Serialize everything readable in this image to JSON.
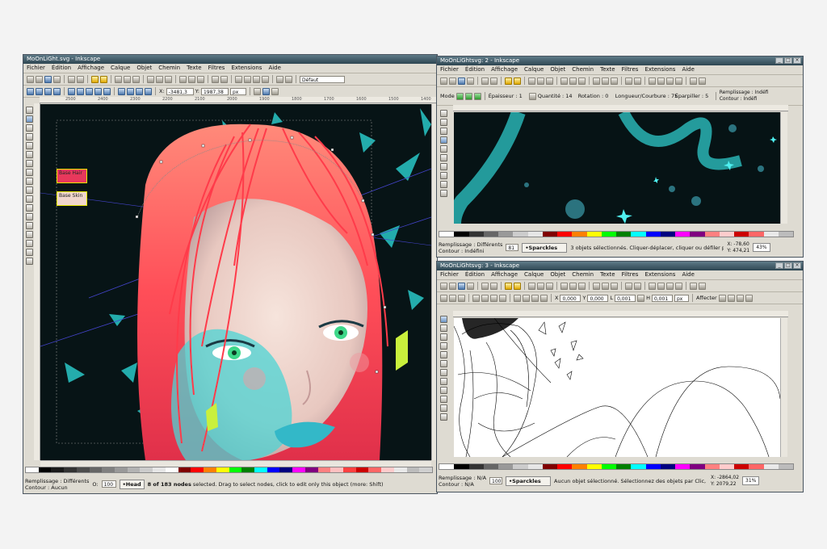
{
  "window1": {
    "title": "MoOnLiGht.svg - Inkscape",
    "menu": [
      "Fichier",
      "Édition",
      "Affichage",
      "Calque",
      "Objet",
      "Chemin",
      "Texte",
      "Filtres",
      "Extensions",
      "Aide"
    ],
    "style_select": "Défaut",
    "x_label": "X:",
    "x_value": "-3481,3",
    "y_label": "Y:",
    "y_value": "1987,38",
    "unit": "px",
    "rulers": [
      "2500",
      "2400",
      "2300",
      "2200",
      "2100",
      "2000",
      "1900",
      "1800",
      "1700",
      "1600",
      "1500",
      "1400"
    ],
    "labels": {
      "base_hair": "Base Hair",
      "base_skin": "Base Skin"
    },
    "status": {
      "fill_label": "Remplissage :",
      "fill_value": "Différents",
      "stroke_label": "Contour :",
      "stroke_value": "Aucun",
      "opacity_label": "O:",
      "opacity": "100",
      "layer": "•Head",
      "message_bold": "8 of 183 nodes",
      "message": " selected. Drag to select nodes, click to edit only this object (more: Shift)"
    }
  },
  "window2": {
    "title": "MoOnLiGhtsvg: 2 - Inkscape",
    "menu": [
      "Fichier",
      "Édition",
      "Affichage",
      "Calque",
      "Objet",
      "Chemin",
      "Texte",
      "Filtres",
      "Extensions",
      "Aide"
    ],
    "mode_label": "Mode",
    "thickness_label": "Épaisseur : 1",
    "quantity_label": "Quantité : 14",
    "rotation_label": "Rotation : 0",
    "length_label": "Longueur/Courbure : 75",
    "scatter_label": "Éparpiller : 5",
    "fill_header": "Remplissage :",
    "fill_header_value": "Indéfi",
    "stroke_header": "Contour :",
    "stroke_header_value": "Indéfi",
    "status": {
      "fill_label": "Remplissage :",
      "fill_value": "Différents",
      "stroke_label": "Contour :",
      "stroke_value": "Indéfini",
      "opacity": "81",
      "layer": "•Sparckles",
      "message": "3 objets sélectionnés. Cliquer-déplacer, cliquer ou défiler pour pul",
      "x": "X: -78,60",
      "y": "Y: 474,21",
      "zoom": "43%"
    }
  },
  "window3": {
    "title": "MoOnLiGhtsvg: 3 - Inkscape",
    "menu": [
      "Fichier",
      "Édition",
      "Affichage",
      "Calque",
      "Objet",
      "Chemin",
      "Texte",
      "Filtres",
      "Extensions",
      "Aide"
    ],
    "fields": [
      "0,000",
      "0,000",
      "0,001",
      "0,001"
    ],
    "unit": "px",
    "apply_label": "Affecter",
    "status": {
      "fill_label": "Remplissage :",
      "fill_value": "N/A",
      "stroke_label": "Contour :",
      "stroke_value": "N/A",
      "opacity": "100",
      "layer": "•Sparckles",
      "message": "Aucun objet sélectionné. Sélectionnez des objets par Clic, Maj",
      "x": "X: -2864,02",
      "y": "Y: 2079,22",
      "zoom": "31%"
    }
  },
  "colors": {
    "title_bg": "#2e4652",
    "chrome": "#dedbd2",
    "hair": "#ff4a4a",
    "cyan": "#2dd4d4",
    "canvas_dark": "#071416"
  }
}
